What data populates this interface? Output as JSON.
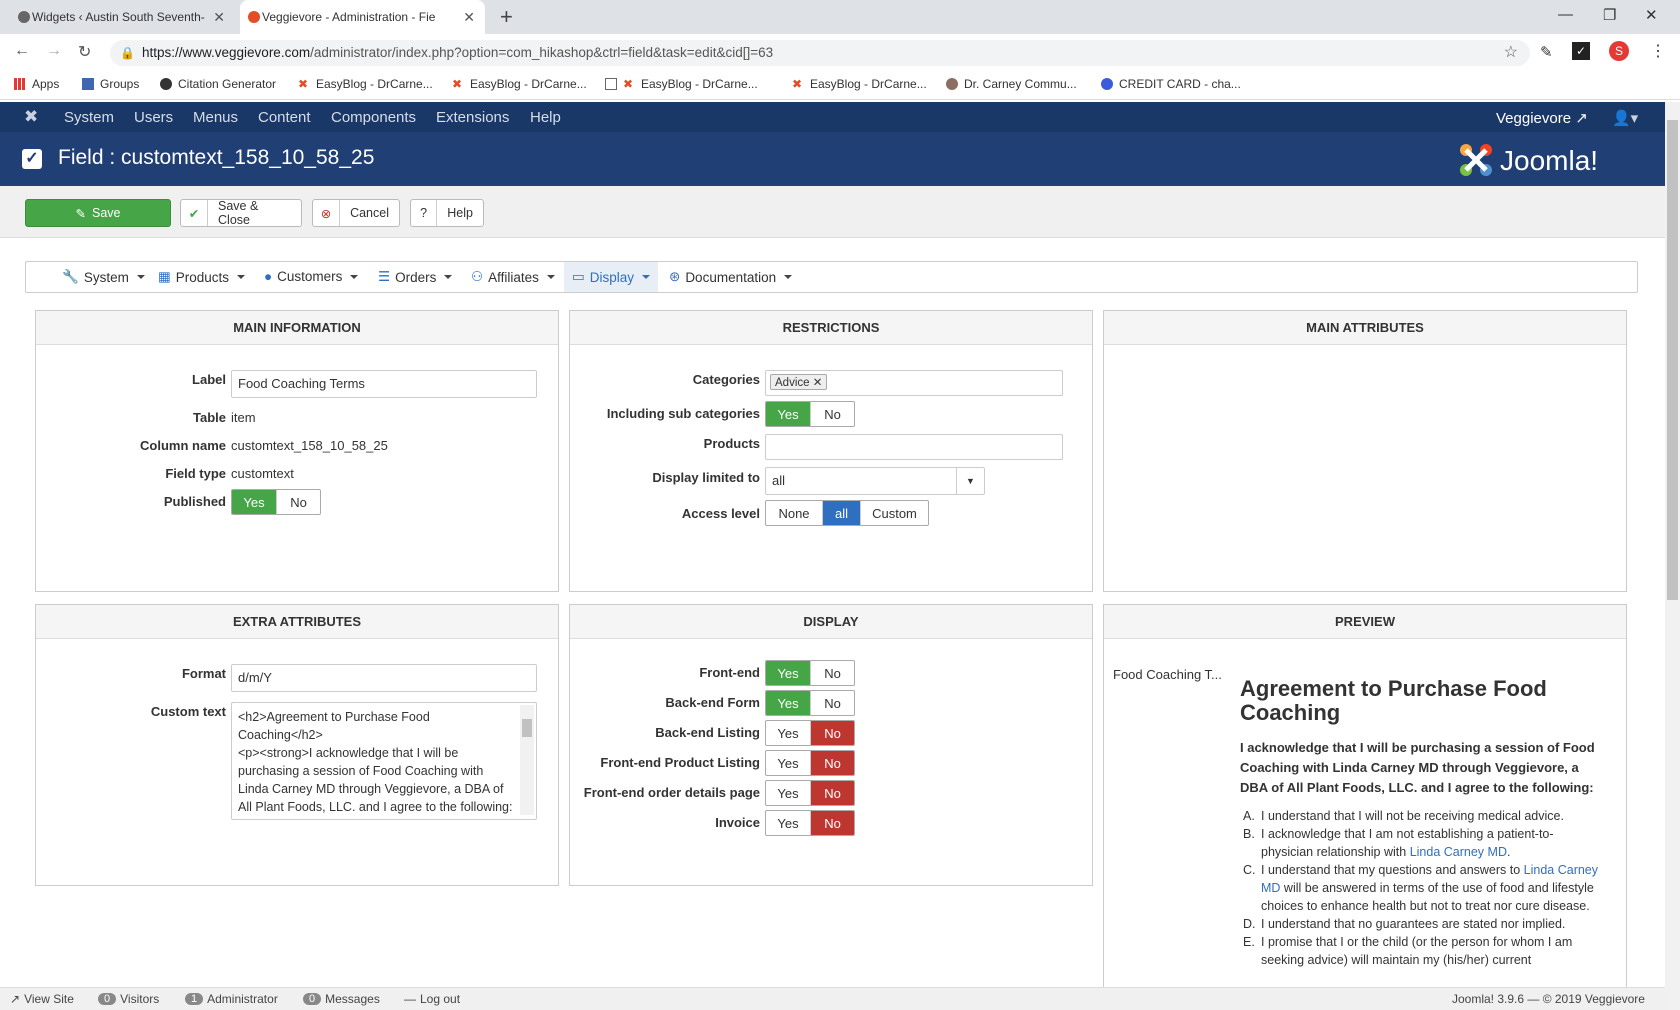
{
  "browser": {
    "tabs": [
      {
        "label": "Widgets ‹ Austin South Seventh-"
      },
      {
        "label": "Veggievore - Administration - Fie"
      }
    ],
    "url_host": "https://www.veggievore.com",
    "url_path": "/administrator/index.php?option=com_hikashop&ctrl=field&task=edit&cid[]=63",
    "profile_initial": "S",
    "bookmarks": [
      "Apps",
      "Groups",
      "Citation Generator",
      "EasyBlog - DrCarne...",
      "EasyBlog - DrCarne...",
      "EasyBlog - DrCarne...",
      "EasyBlog - DrCarne...",
      "Dr. Carney Commu...",
      "CREDIT CARD - cha..."
    ]
  },
  "topnav": {
    "items": [
      "System",
      "Users",
      "Menus",
      "Content",
      "Components",
      "Extensions",
      "Help"
    ],
    "site": "Veggievore"
  },
  "header": {
    "title": "Field : customtext_158_10_58_25",
    "logo": "Joomla!"
  },
  "toolbar": {
    "save": "Save",
    "save_close": "Save & Close",
    "cancel": "Cancel",
    "help": "Help"
  },
  "menu": {
    "items": [
      "System",
      "Products",
      "Customers",
      "Orders",
      "Affiliates",
      "Display",
      "Documentation"
    ]
  },
  "main_info": {
    "heading": "MAIN INFORMATION",
    "label_lbl": "Label",
    "label_val": "Food Coaching Terms",
    "table_lbl": "Table",
    "table_val": "item",
    "column_lbl": "Column name",
    "column_val": "customtext_158_10_58_25",
    "type_lbl": "Field type",
    "type_val": "customtext",
    "published_lbl": "Published",
    "yes": "Yes",
    "no": "No"
  },
  "restrictions": {
    "heading": "RESTRICTIONS",
    "categories_lbl": "Categories",
    "category_tag": "Advice",
    "subcat_lbl": "Including sub categories",
    "products_lbl": "Products",
    "limited_lbl": "Display limited to",
    "limited_val": "all",
    "access_lbl": "Access level",
    "access_none": "None",
    "access_all": "all",
    "access_custom": "Custom",
    "yes": "Yes",
    "no": "No"
  },
  "main_attributes": {
    "heading": "MAIN ATTRIBUTES"
  },
  "extra": {
    "heading": "EXTRA ATTRIBUTES",
    "format_lbl": "Format",
    "format_val": "d/m/Y",
    "custom_lbl": "Custom text",
    "custom_val": "<h2>Agreement to Purchase Food Coaching</h2>\n<p><strong>I acknowledge that I will be purchasing a session of Food Coaching with Linda Carney MD through Veggievore, a DBA of All Plant Foods, LLC. and I agree to the following:"
  },
  "display": {
    "heading": "DISPLAY",
    "rows": [
      {
        "label": "Front-end",
        "state": "yes"
      },
      {
        "label": "Back-end Form",
        "state": "yes"
      },
      {
        "label": "Back-end Listing",
        "state": "no"
      },
      {
        "label": "Front-end Product Listing",
        "state": "no"
      },
      {
        "label": "Front-end order details page",
        "state": "no"
      },
      {
        "label": "Invoice",
        "state": "no"
      }
    ],
    "yes": "Yes",
    "no": "No"
  },
  "preview": {
    "heading": "PREVIEW",
    "label": "Food Coaching T...",
    "title": "Agreement to Purchase Food Coaching",
    "intro": "I acknowledge that I will be purchasing a session of Food Coaching with Linda Carney MD through Veggievore, a DBA of All Plant Foods, LLC. and I agree to the following:",
    "items": [
      {
        "m": "A.",
        "t": "I understand that I will not be receiving medical advice."
      },
      {
        "m": "B.",
        "t": "I acknowledge that I am not establishing a patient-to-physician relationship with ",
        "link": "Linda Carney MD",
        "after": "."
      },
      {
        "m": "C.",
        "t": "I understand that my questions and answers to ",
        "link": "Linda Carney MD",
        "after": " will be answered in terms of the use of food and lifestyle choices to enhance health but not to treat nor cure disease."
      },
      {
        "m": "D.",
        "t": "I understand that no guarantees are stated nor implied."
      },
      {
        "m": "E.",
        "t": "I promise that I or the child (or the person for whom I am seeking advice) will maintain my (his/her) current"
      }
    ]
  },
  "footer": {
    "view_site": "View Site",
    "visitors_count": "0",
    "visitors": "Visitors",
    "admin_count": "1",
    "admin": "Administrator",
    "messages_count": "0",
    "messages": "Messages",
    "logout": "Log out",
    "version": "Joomla! 3.9.6 — © 2019 Veggievore"
  }
}
